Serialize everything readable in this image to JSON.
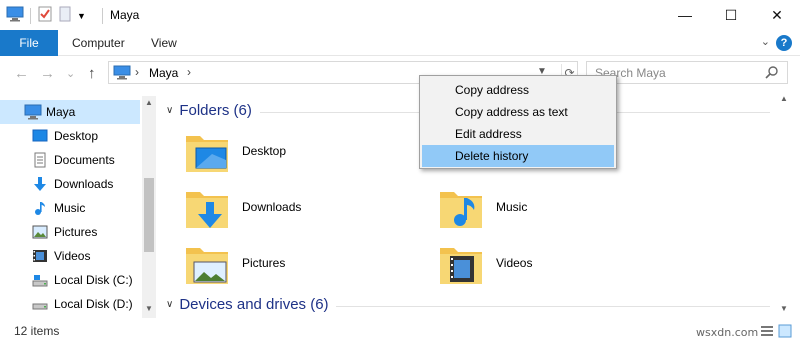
{
  "window": {
    "title": "Maya",
    "controls": {
      "minimize": "—",
      "maximize": "☐",
      "close": "✕"
    }
  },
  "ribbon": {
    "tabs": [
      "File",
      "Computer",
      "View"
    ],
    "help": "?",
    "collapse": "⌄"
  },
  "nav": {
    "back": "←",
    "forward": "→",
    "recent": "⌄",
    "up": "↑",
    "address": {
      "separator": "›",
      "location": "Maya"
    },
    "search_placeholder": "Search Maya"
  },
  "sidebar": {
    "items": [
      {
        "label": "Maya",
        "icon": "computer-icon",
        "selected": true
      },
      {
        "label": "Desktop",
        "icon": "desktop-icon"
      },
      {
        "label": "Documents",
        "icon": "documents-icon"
      },
      {
        "label": "Downloads",
        "icon": "downloads-icon"
      },
      {
        "label": "Music",
        "icon": "music-icon"
      },
      {
        "label": "Pictures",
        "icon": "pictures-icon"
      },
      {
        "label": "Videos",
        "icon": "videos-icon"
      },
      {
        "label": "Local Disk (C:)",
        "icon": "local-disk-c-icon"
      },
      {
        "label": "Local Disk (D:)",
        "icon": "local-disk-d-icon"
      }
    ]
  },
  "main": {
    "folders_header": "Folders (6)",
    "folders": [
      {
        "label": "Desktop",
        "icon": "desktop-folder-icon"
      },
      {
        "label": "Downloads",
        "icon": "downloads-folder-icon"
      },
      {
        "label": "Music",
        "icon": "music-folder-icon"
      },
      {
        "label": "Pictures",
        "icon": "pictures-folder-icon"
      },
      {
        "label": "Videos",
        "icon": "videos-folder-icon"
      }
    ],
    "devices_header": "Devices and drives (6)"
  },
  "context_menu": {
    "items": [
      {
        "label": "Copy address",
        "highlighted": false
      },
      {
        "label": "Copy address as text",
        "highlighted": false
      },
      {
        "label": "Edit address",
        "highlighted": false
      },
      {
        "label": "Delete history",
        "highlighted": true
      }
    ]
  },
  "status": {
    "item_count": "12 items",
    "watermark": "wsxdn.com"
  },
  "colors": {
    "accent": "#1979ca",
    "selection": "#cce8ff",
    "menu_highlight": "#91c9f7",
    "group_header": "#1e3287",
    "folder": "#f3c24e"
  }
}
